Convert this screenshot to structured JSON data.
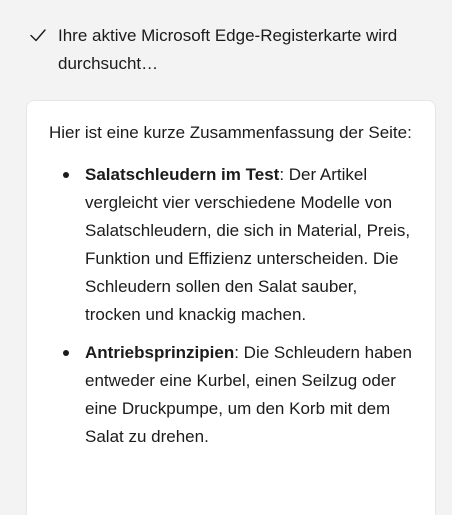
{
  "status": {
    "icon": "check-icon",
    "text": "Ihre aktive Microsoft Edge-Registerkarte wird durchsucht…"
  },
  "summary": {
    "intro": "Hier ist eine kurze Zusammenfassung der Seite:",
    "items": [
      {
        "title": "Salatschleudern im Test",
        "text": ": Der Artikel vergleicht vier verschiedene Modelle von Salatschleudern, die sich in Material, Preis, Funktion und Effizienz unterscheiden. Die Schleudern sollen den Salat sauber, trocken und knackig machen."
      },
      {
        "title": "Antriebsprinzipien",
        "text": ": Die Schleudern haben entweder eine Kurbel, einen Seilzug oder eine Druckpumpe, um den Korb mit dem Salat zu drehen."
      }
    ]
  }
}
